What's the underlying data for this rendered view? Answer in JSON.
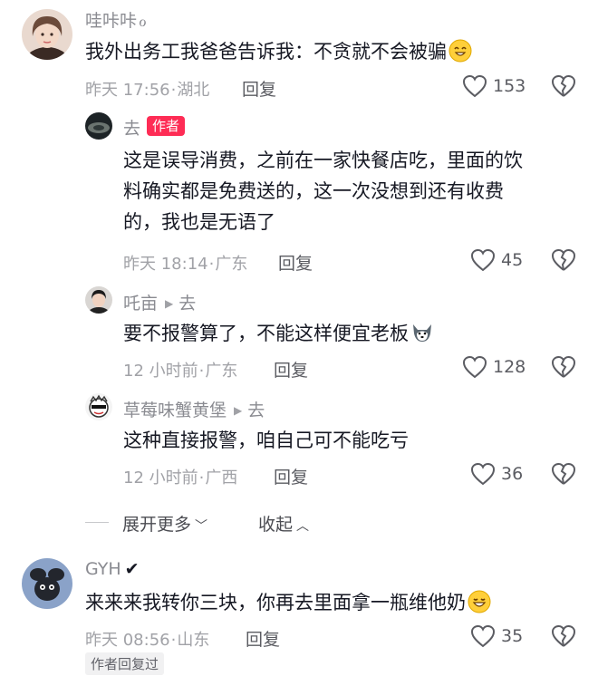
{
  "comments": [
    {
      "username": "哇咔咔",
      "username_suffix": "ℴ",
      "text": "我外出务工我爸爸告诉我：不贪就不会被骗",
      "emoji": "smile-emoji",
      "time": "昨天 17:56",
      "location": "湖北",
      "reply_label": "回复",
      "likes": "153"
    },
    {
      "username": "去",
      "badge": "作者",
      "text_lines": [
        "这是误导消费，之前在一家快餐店吃，里面的饮",
        "料确实都是免费送的，这一次没想到还有收费",
        "的，我也是无语了"
      ],
      "time": "昨天 18:14",
      "location": "广东",
      "reply_label": "回复",
      "likes": "45"
    },
    {
      "username": "吒亩",
      "reply_to": "去",
      "text": "要不报警算了，不能这样便宜老板",
      "emoji": "husky-emoji",
      "time": "12 小时前",
      "location": "广东",
      "reply_label": "回复",
      "likes": "128"
    },
    {
      "username": "草莓味蟹黄堡",
      "reply_to": "去",
      "text": "这种直接报警，咱自己可不能吃亏",
      "time": "12 小时前",
      "location": "广西",
      "reply_label": "回复",
      "likes": "36"
    },
    {
      "username": "GYH",
      "username_suffix": "✔",
      "text": "来来来我转你三块，你再去里面拿一瓶维他奶",
      "emoji": "grin-emoji",
      "time": "昨天 08:56",
      "location": "山东",
      "reply_label": "回复",
      "likes": "35",
      "tag": "作者回复过"
    }
  ],
  "thread": {
    "expand_label": "展开更多",
    "collapse_label": "收起"
  },
  "separator": "·",
  "colors": {
    "badge": "#fe2c55",
    "text": "#161823",
    "meta": "#a1a2a7"
  }
}
